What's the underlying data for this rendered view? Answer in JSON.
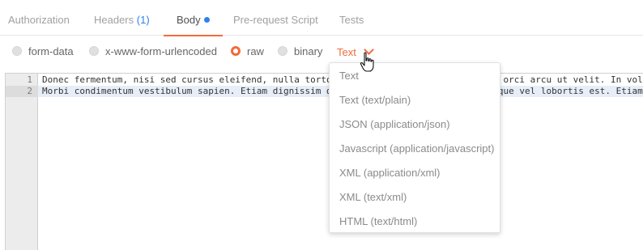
{
  "tabs": [
    {
      "label": "Authorization",
      "count": ""
    },
    {
      "label": "Headers",
      "count": "(1)"
    },
    {
      "label": "Body",
      "count": ""
    },
    {
      "label": "Pre-request Script",
      "count": ""
    },
    {
      "label": "Tests",
      "count": ""
    }
  ],
  "active_tab": "Body",
  "body_modes": [
    {
      "label": "form-data",
      "checked": false
    },
    {
      "label": "x-www-form-urlencoded",
      "checked": false
    },
    {
      "label": "raw",
      "checked": true
    },
    {
      "label": "binary",
      "checked": false
    }
  ],
  "content_type": {
    "selected": "Text",
    "icon": "chevron-down-icon"
  },
  "editor": {
    "lines": [
      {
        "number": "1",
        "text": "Donec fermentum, nisi sed cursus eleifend, nulla tortor ultricies tellus, ut vehicula orci arcu ut velit. In volutpat"
      },
      {
        "number": "2",
        "text": "Morbi condimentum vestibulum sapien. Etiam dignissim diam quis enim lobortis scelerisque vel lobortis est. Etiam gravida"
      }
    ]
  },
  "dropdown": {
    "options": [
      "Text",
      "Text (text/plain)",
      "JSON (application/json)",
      "Javascript (application/javascript)",
      "XML (application/xml)",
      "XML (text/xml)",
      "HTML (text/html)"
    ]
  },
  "colors": {
    "accent": "#f26b3a",
    "badge": "#2f80ed",
    "selection": "#e7eef8"
  }
}
